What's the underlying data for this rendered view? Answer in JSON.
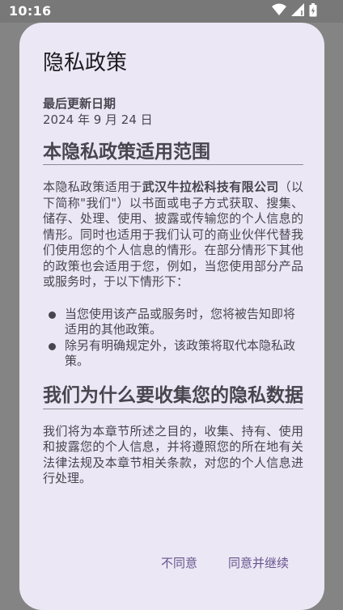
{
  "status_bar": {
    "time": "10:16",
    "icons": [
      "wifi-icon",
      "cellular-signal-icon",
      "battery-charging-icon"
    ]
  },
  "dialog": {
    "title": "隐私政策",
    "last_updated_label": "最后更新日期",
    "last_updated_date": "2024 年 9 月 24 日",
    "section1": {
      "heading": "本隐私政策适用范围",
      "para_prefix": "本隐私政策适用于",
      "company_name": "武汉牛拉松科技有限公司",
      "para_suffix": "（以下简称\"我们\"）以书面或电子方式获取、搜集、储存、处理、使用、披露或传输您的个人信息的情形。同时也适用于我们认可的商业伙伴代替我们使用您的个人信息的情形。在部分情形下其他的政策也会适用于您，例如，当您使用部分产品或服务时，于以下情形下：",
      "bullets": [
        "当您使用该产品或服务时，您将被告知即将适用的其他政策。",
        "除另有明确规定外，该政策将取代本隐私政策。"
      ]
    },
    "section2": {
      "heading": "我们为什么要收集您的隐私数据",
      "para": "我们将为本章节所述之目的，收集、持有、使用和披露您的个人信息，并将遵照您的所在地有关法律法规及本章节相关条款，对您的个人信息进行处理。"
    },
    "actions": {
      "decline": "不同意",
      "accept": "同意并继续"
    }
  },
  "colors": {
    "scrim": "#848484",
    "dialog_bg": "#ece7f4",
    "title": "#1d1b20",
    "body_text": "#49454f",
    "action_text": "#65558f"
  }
}
